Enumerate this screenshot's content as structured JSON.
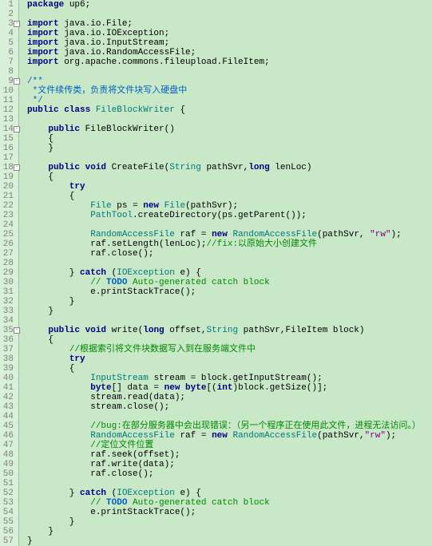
{
  "lines": [
    {
      "n": 1,
      "f": 0,
      "t": [
        [
          "kw",
          "package"
        ],
        [
          "",
          " up6;"
        ]
      ]
    },
    {
      "n": 2,
      "f": 0,
      "t": [
        [
          "",
          ""
        ]
      ]
    },
    {
      "n": 3,
      "f": 1,
      "t": [
        [
          "kw",
          "import"
        ],
        [
          "",
          " java.io.File;"
        ]
      ]
    },
    {
      "n": 4,
      "f": 0,
      "t": [
        [
          "kw",
          "import"
        ],
        [
          "",
          " java.io.IOException;"
        ]
      ]
    },
    {
      "n": 5,
      "f": 0,
      "t": [
        [
          "kw",
          "import"
        ],
        [
          "",
          " java.io.InputStream;"
        ]
      ]
    },
    {
      "n": 6,
      "f": 0,
      "t": [
        [
          "kw",
          "import"
        ],
        [
          "",
          " java.io.RandomAccessFile;"
        ]
      ]
    },
    {
      "n": 7,
      "f": 0,
      "t": [
        [
          "kw",
          "import"
        ],
        [
          "",
          " org.apache.commons.fileupload.FileItem;"
        ]
      ]
    },
    {
      "n": 8,
      "f": 0,
      "t": [
        [
          "",
          ""
        ]
      ]
    },
    {
      "n": 9,
      "f": 1,
      "t": [
        [
          "javadoc",
          "/**"
        ]
      ]
    },
    {
      "n": 10,
      "f": 0,
      "t": [
        [
          "javadoc",
          " *文件续传类，负责将文件块写入硬盘中"
        ]
      ]
    },
    {
      "n": 11,
      "f": 0,
      "t": [
        [
          "javadoc",
          " */"
        ]
      ]
    },
    {
      "n": 12,
      "f": 0,
      "t": [
        [
          "kw",
          "public class "
        ],
        [
          "cls",
          "FileBlockWriter"
        ],
        [
          "",
          " {"
        ]
      ]
    },
    {
      "n": 13,
      "f": 0,
      "t": [
        [
          "",
          ""
        ]
      ]
    },
    {
      "n": 14,
      "f": 1,
      "t": [
        [
          "",
          "    "
        ],
        [
          "kw",
          "public"
        ],
        [
          "",
          " FileBlockWriter()"
        ]
      ]
    },
    {
      "n": 15,
      "f": 0,
      "t": [
        [
          "",
          "    {"
        ]
      ]
    },
    {
      "n": 16,
      "f": 0,
      "t": [
        [
          "",
          "    }"
        ]
      ]
    },
    {
      "n": 17,
      "f": 0,
      "t": [
        [
          "",
          ""
        ]
      ]
    },
    {
      "n": 18,
      "f": 1,
      "t": [
        [
          "",
          "    "
        ],
        [
          "kw",
          "public void"
        ],
        [
          "",
          " CreateFile("
        ],
        [
          "cls",
          "String"
        ],
        [
          "",
          " pathSvr,"
        ],
        [
          "kw",
          "long"
        ],
        [
          "",
          " lenLoc)"
        ]
      ]
    },
    {
      "n": 19,
      "f": 0,
      "t": [
        [
          "",
          "    {"
        ]
      ]
    },
    {
      "n": 20,
      "f": 0,
      "t": [
        [
          "",
          "        "
        ],
        [
          "kw",
          "try"
        ]
      ]
    },
    {
      "n": 21,
      "f": 0,
      "t": [
        [
          "",
          "        {"
        ]
      ]
    },
    {
      "n": 22,
      "f": 0,
      "t": [
        [
          "",
          "            "
        ],
        [
          "cls",
          "File"
        ],
        [
          "",
          " ps = "
        ],
        [
          "kw",
          "new"
        ],
        [
          "",
          " "
        ],
        [
          "cls",
          "File"
        ],
        [
          "",
          "(pathSvr);"
        ]
      ]
    },
    {
      "n": 23,
      "f": 0,
      "t": [
        [
          "",
          "            "
        ],
        [
          "cls",
          "PathTool"
        ],
        [
          "",
          ".createDirectory(ps.getParent());"
        ]
      ]
    },
    {
      "n": 24,
      "f": 0,
      "t": [
        [
          "",
          ""
        ]
      ]
    },
    {
      "n": 25,
      "f": 0,
      "t": [
        [
          "",
          "            "
        ],
        [
          "cls",
          "RandomAccessFile"
        ],
        [
          "",
          " raf = "
        ],
        [
          "kw",
          "new"
        ],
        [
          "",
          " "
        ],
        [
          "cls",
          "RandomAccessFile"
        ],
        [
          "",
          "(pathSvr, "
        ],
        [
          "str",
          "\"rw\""
        ],
        [
          "",
          ");"
        ]
      ]
    },
    {
      "n": 26,
      "f": 0,
      "t": [
        [
          "",
          "            raf.setLength(lenLoc);"
        ],
        [
          "cmt",
          "//fix:以原始大小创建文件"
        ]
      ]
    },
    {
      "n": 27,
      "f": 0,
      "t": [
        [
          "",
          "            raf.close();"
        ]
      ]
    },
    {
      "n": 28,
      "f": 0,
      "t": [
        [
          "",
          ""
        ]
      ]
    },
    {
      "n": 29,
      "f": 0,
      "t": [
        [
          "",
          "        } "
        ],
        [
          "kw",
          "catch"
        ],
        [
          "",
          " ("
        ],
        [
          "cls",
          "IOException"
        ],
        [
          "",
          " e) {"
        ]
      ]
    },
    {
      "n": 30,
      "f": 0,
      "t": [
        [
          "",
          "            "
        ],
        [
          "cmt",
          "// "
        ],
        [
          "todo",
          "TODO"
        ],
        [
          "cmt",
          " Auto-generated catch block"
        ]
      ]
    },
    {
      "n": 31,
      "f": 0,
      "t": [
        [
          "",
          "            e.printStackTrace();"
        ]
      ]
    },
    {
      "n": 32,
      "f": 0,
      "t": [
        [
          "",
          "        }"
        ]
      ]
    },
    {
      "n": 33,
      "f": 0,
      "t": [
        [
          "",
          "    }"
        ]
      ]
    },
    {
      "n": 34,
      "f": 0,
      "t": [
        [
          "",
          ""
        ]
      ]
    },
    {
      "n": 35,
      "f": 1,
      "t": [
        [
          "",
          "    "
        ],
        [
          "kw",
          "public void"
        ],
        [
          "",
          " write("
        ],
        [
          "kw",
          "long"
        ],
        [
          "",
          " offset,"
        ],
        [
          "cls",
          "String"
        ],
        [
          "",
          " pathSvr,FileItem block)"
        ]
      ]
    },
    {
      "n": 36,
      "f": 0,
      "t": [
        [
          "",
          "    {"
        ]
      ]
    },
    {
      "n": 37,
      "f": 0,
      "t": [
        [
          "",
          "        "
        ],
        [
          "cmt",
          "//根据索引将文件块数据写入到在服务端文件中"
        ]
      ]
    },
    {
      "n": 38,
      "f": 0,
      "t": [
        [
          "",
          "        "
        ],
        [
          "kw",
          "try"
        ]
      ]
    },
    {
      "n": 39,
      "f": 0,
      "t": [
        [
          "",
          "        {"
        ]
      ]
    },
    {
      "n": 40,
      "f": 0,
      "t": [
        [
          "",
          "            "
        ],
        [
          "cls",
          "InputStream"
        ],
        [
          "",
          " stream = block.getInputStream();"
        ]
      ]
    },
    {
      "n": 41,
      "f": 0,
      "t": [
        [
          "",
          "            "
        ],
        [
          "kw",
          "byte"
        ],
        [
          "",
          "[] data = "
        ],
        [
          "kw",
          "new byte"
        ],
        [
          "",
          "[("
        ],
        [
          "kw",
          "int"
        ],
        [
          "",
          ")block.getSize()];"
        ]
      ]
    },
    {
      "n": 42,
      "f": 0,
      "t": [
        [
          "",
          "            stream.read(data);"
        ]
      ]
    },
    {
      "n": 43,
      "f": 0,
      "t": [
        [
          "",
          "            stream.close();"
        ]
      ]
    },
    {
      "n": 44,
      "f": 0,
      "t": [
        [
          "",
          ""
        ]
      ]
    },
    {
      "n": 45,
      "f": 0,
      "t": [
        [
          "",
          "            "
        ],
        [
          "cmt",
          "//bug:在部分服务器中会出现错误：（另一个程序正在使用此文件，进程无法访问。）"
        ]
      ]
    },
    {
      "n": 46,
      "f": 0,
      "t": [
        [
          "",
          "            "
        ],
        [
          "cls",
          "RandomAccessFile"
        ],
        [
          "",
          " raf = "
        ],
        [
          "kw",
          "new"
        ],
        [
          "",
          " "
        ],
        [
          "cls",
          "RandomAccessFile"
        ],
        [
          "",
          "(pathSvr,"
        ],
        [
          "str",
          "\"rw\""
        ],
        [
          "",
          ");"
        ]
      ]
    },
    {
      "n": 47,
      "f": 0,
      "t": [
        [
          "",
          "            "
        ],
        [
          "cmt",
          "//定位文件位置"
        ]
      ]
    },
    {
      "n": 48,
      "f": 0,
      "t": [
        [
          "",
          "            raf.seek(offset);"
        ]
      ]
    },
    {
      "n": 49,
      "f": 0,
      "t": [
        [
          "",
          "            raf.write(data);"
        ]
      ]
    },
    {
      "n": 50,
      "f": 0,
      "t": [
        [
          "",
          "            raf.close();"
        ]
      ]
    },
    {
      "n": 51,
      "f": 0,
      "t": [
        [
          "",
          ""
        ]
      ]
    },
    {
      "n": 52,
      "f": 0,
      "t": [
        [
          "",
          "        } "
        ],
        [
          "kw",
          "catch"
        ],
        [
          "",
          " ("
        ],
        [
          "cls",
          "IOException"
        ],
        [
          "",
          " e) {"
        ]
      ]
    },
    {
      "n": 53,
      "f": 0,
      "t": [
        [
          "",
          "            "
        ],
        [
          "cmt",
          "// "
        ],
        [
          "todo",
          "TODO"
        ],
        [
          "cmt",
          " Auto-generated catch block"
        ]
      ]
    },
    {
      "n": 54,
      "f": 0,
      "t": [
        [
          "",
          "            e.printStackTrace();"
        ]
      ]
    },
    {
      "n": 55,
      "f": 0,
      "t": [
        [
          "",
          "        }"
        ]
      ]
    },
    {
      "n": 56,
      "f": 0,
      "t": [
        [
          "",
          "    }"
        ]
      ]
    },
    {
      "n": 57,
      "f": 0,
      "t": [
        [
          "",
          "}"
        ]
      ]
    }
  ]
}
